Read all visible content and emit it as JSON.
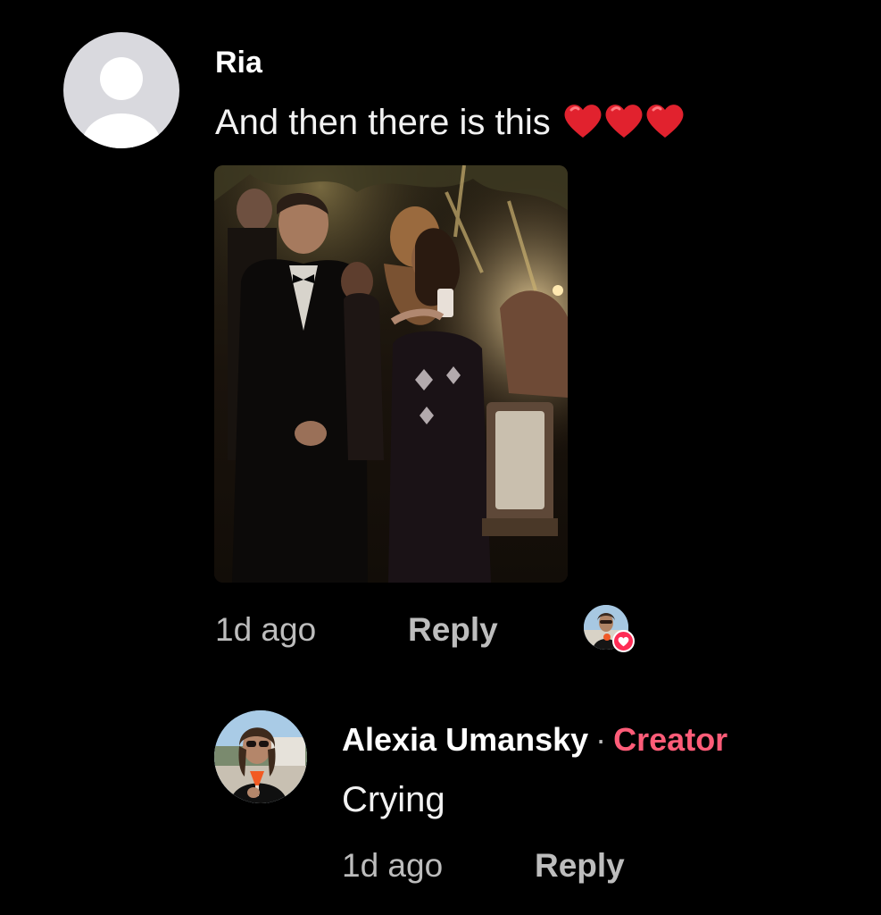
{
  "comment": {
    "username": "Ria",
    "text": "And then there is this",
    "emoji_count": 3,
    "emoji_icon": "red-heart-icon",
    "media_icon": "video-thumbnail",
    "time": "1d ago",
    "reply_label": "Reply",
    "creator_liked": true
  },
  "reply": {
    "username": "Alexia Umansky",
    "separator": "·",
    "badge": "Creator",
    "text": "Crying",
    "time": "1d ago",
    "reply_label": "Reply"
  },
  "colors": {
    "background": "#000000",
    "primary_text": "#ffffff",
    "secondary_text": "#bdbdbd",
    "creator_badge": "#fe5c78",
    "like_badge": "#fe2c55"
  }
}
